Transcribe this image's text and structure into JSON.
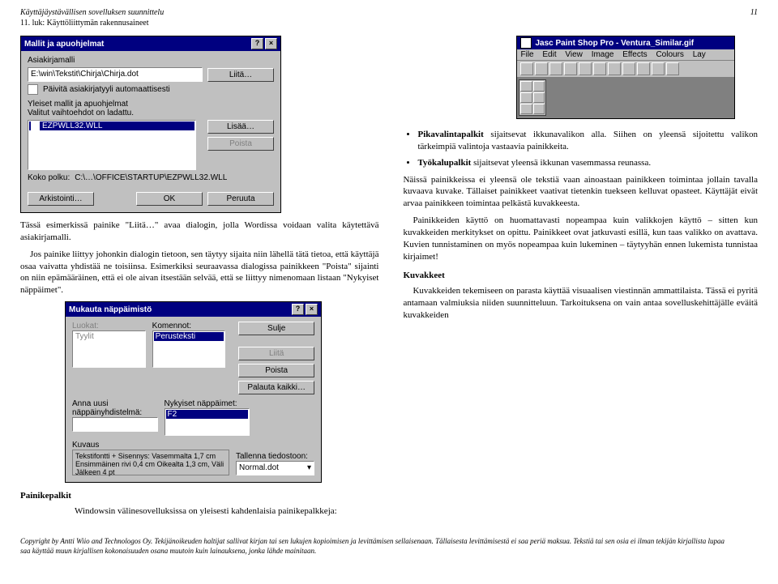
{
  "header": {
    "title": "Käyttäjäystävällisen sovelluksen suunnittelu",
    "subtitle": "11. luk: Käyttöliittymän rakennusaineet",
    "page": "11"
  },
  "dialog1": {
    "title": "Mallit ja apuohjelmat",
    "help_btn": "?",
    "close_btn": "×",
    "label_asiakirjamalli": "Asiakirjamalli",
    "asiakirjamalli_value": "E:\\win\\Tekstit\\Chirja\\Chirja.dot",
    "btn_liita": "Liitä…",
    "checkbox_label": "Päivitä asiakirjatyyli automaattisesti",
    "label_yleiset": "Yleiset mallit ja apuohjelmat",
    "label_valitut": "Valitut vaihtoehdot on ladattu.",
    "list_item": "EZPWLL32.WLL",
    "btn_lisaa": "Lisää…",
    "btn_poista": "Poista",
    "koko_polku_label": "Koko polku:",
    "koko_polku_value": "C:\\…\\OFFICE\\STARTUP\\EZPWLL32.WLL",
    "btn_arkistointi": "Arkistointi…",
    "btn_ok": "OK",
    "btn_peruuta": "Peruuta"
  },
  "psp": {
    "title": "Jasc Paint Shop Pro - Ventura_Similar.gif",
    "menu": {
      "file": "File",
      "edit": "Edit",
      "view": "View",
      "image": "Image",
      "effects": "Effects",
      "colours": "Colours",
      "lay": "Lay"
    }
  },
  "dialog2": {
    "title": "Mukauta näppäimistö",
    "label_luokat": "Luokat:",
    "luokat_item": "Tyylit",
    "label_komennot": "Komennot:",
    "komennot_item": "Perusteksti",
    "btn_sulje": "Sulje",
    "btn_liita2": "Liitä",
    "btn_poista2": "Poista",
    "btn_palauta": "Palauta kaikki…",
    "label_anna": "Anna uusi näppäinyhdistelmä:",
    "label_nykyiset": "Nykyiset näppäimet:",
    "nykyiset_item": "F2",
    "label_kuvaus": "Kuvaus",
    "kuvaus_text": "Tekstifontti + Sisennys: Vasemmalta 1,7 cm Ensimmäinen rivi 0,4 cm Oikealta 1,3 cm, Väli Jälkeen 4 pt",
    "label_tallenna": "Tallenna tiedostoon:",
    "tallenna_value": "Normal.dot"
  },
  "body": {
    "p1": "Tässä esimerkissä painike \"Liitä…\" avaa dialogin, jolla Wordissa voidaan valita käytettävä asiakirjamalli.",
    "p2": "Jos painike liittyy johonkin dialogin tietoon, sen täytyy sijaita niin lähellä tätä tietoa, että käyttäjä osaa vaivatta yhdistää ne toisiinsa. Esimerkiksi seuraavassa dialogissa painikkeen \"Poista\" sijainti on niin epämääräinen, että ei ole aivan itsestään selvää, että se liittyy nimenomaan listaan \"Nykyiset näppäimet\".",
    "h_painikepalkit": "Painikepalkit",
    "p3": "Windowsin välinesovelluksissa on yleisesti kahdenlaisia painikepalkkeja:",
    "bullet1_strong": "Pikavalintapalkit",
    "bullet1_rest": " sijaitsevat ikkunavalikon alla. Siihen on yleensä sijoitettu valikon tärkeimpiä valintoja vastaavia painikkeita.",
    "bullet2_strong": "Työkalupalkit",
    "bullet2_rest": " sijaitsevat yleensä ikkunan vasemmassa reunassa.",
    "p4": "Näissä painikkeissa ei yleensä ole tekstiä vaan ainoastaan painikkeen toimintaa jollain tavalla kuvaava kuvake. Tällaiset painikkeet vaativat tietenkin tuekseen kelluvat opasteet. Käyttäjät eivät arvaa painikkeen toimintaa pelkästä kuvakkeesta.",
    "p5": "Painikkeiden käyttö on huomattavasti nopeampaa kuin valikkojen käyttö – sitten kun kuvakkeiden merkitykset on opittu. Painikkeet ovat jatkuvasti esillä, kun taas valikko on avattava. Kuvien tunnistaminen on myös nopeampaa kuin lukeminen – täytyyhän ennen lukemista tunnistaa kirjaimet!",
    "h_kuvakkeet": "Kuvakkeet",
    "p6": "Kuvakkeiden tekemiseen on parasta käyttää visuaalisen viestinnän ammattilaista. Tässä ei pyritä antamaan valmiuksia niiden suunnitteluun. Tarkoituksena on vain antaa sovelluskehittäjälle eväitä kuvakkeiden"
  },
  "footer": {
    "line1": "Copyright by Antti Wiio and Technologos Oy.  Tekijänoikeuden haltijat sallivat kirjan tai sen lukujen kopioimisen ja levittämisen sellaisenaan. Tällaisesta levittämisestä ei saa periä maksua. Tekstiä tai sen osia ei ilman tekijän kirjallista lupaa",
    "line2": "saa käyttää muun kirjallisen kokonaisuuden osana muutoin kuin lainauksena, jonka lähde mainitaan."
  }
}
